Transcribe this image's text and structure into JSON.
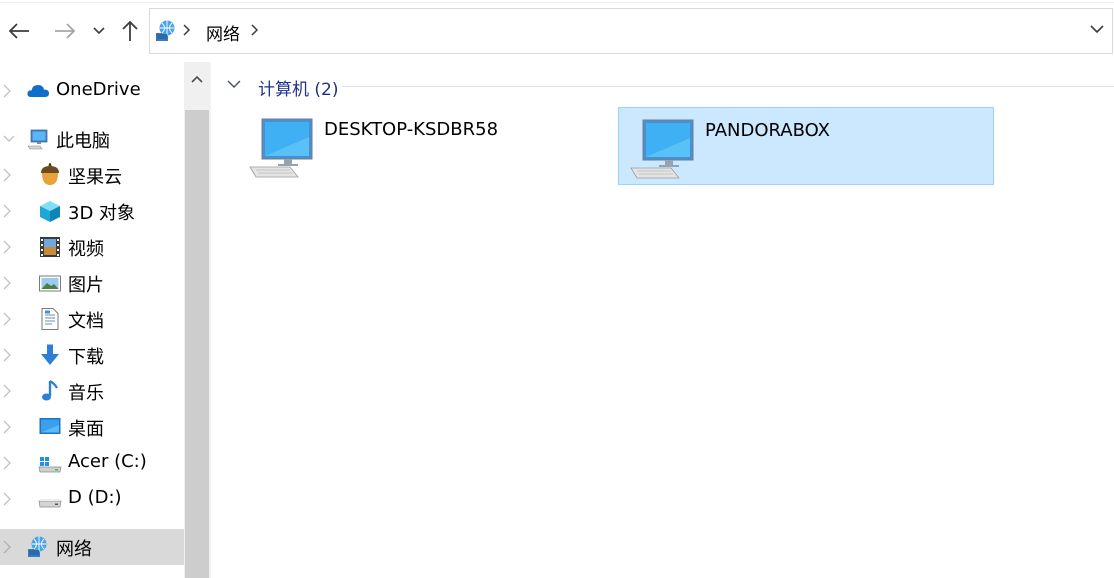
{
  "address_bar": {
    "location": "网络"
  },
  "sidebar": {
    "items": [
      {
        "label": "OneDrive",
        "icon": "cloud-icon"
      },
      {
        "label": "此电脑",
        "icon": "computer-icon"
      },
      {
        "label": "坚果云",
        "icon": "acorn-icon"
      },
      {
        "label": "3D 对象",
        "icon": "cube-3d-icon"
      },
      {
        "label": "视频",
        "icon": "film-icon"
      },
      {
        "label": "图片",
        "icon": "picture-icon"
      },
      {
        "label": "文档",
        "icon": "document-icon"
      },
      {
        "label": "下载",
        "icon": "download-arrow-icon"
      },
      {
        "label": "音乐",
        "icon": "music-note-icon"
      },
      {
        "label": "桌面",
        "icon": "desktop-icon"
      },
      {
        "label": "Acer (C:)",
        "icon": "windows-drive-icon"
      },
      {
        "label": "D (D:)",
        "icon": "drive-icon"
      },
      {
        "label": "网络",
        "icon": "network-icon",
        "selected": true
      }
    ]
  },
  "main": {
    "group": {
      "label": "计算机 (2)"
    },
    "items": [
      {
        "label": "DESKTOP-KSDBR58",
        "icon": "computer-icon",
        "selected": false
      },
      {
        "label": "PANDORABOX",
        "icon": "computer-icon",
        "selected": true
      }
    ]
  },
  "colors": {
    "selection_fill": "#cce8ff",
    "selection_border": "#99d1ff",
    "group_header_text": "#1e3287",
    "sidebar_selected": "#d9d9d9"
  }
}
